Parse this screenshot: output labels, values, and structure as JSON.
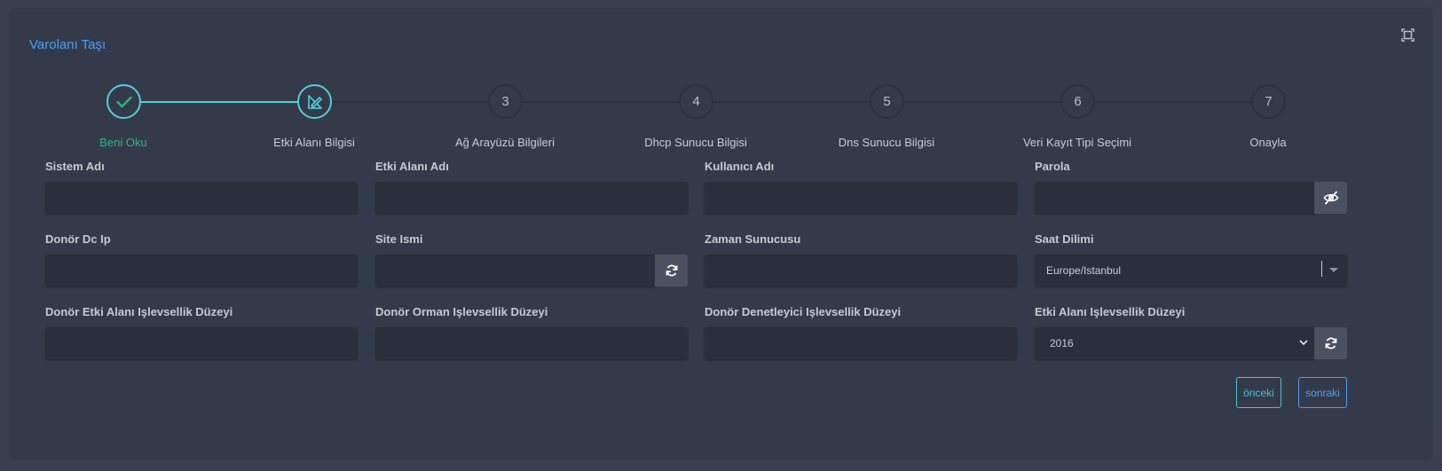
{
  "title": "Varolanı Taşı",
  "steps": [
    {
      "num": "1",
      "label": "Beni Oku",
      "state": "done"
    },
    {
      "num": "2",
      "label": "Etki Alanı Bilgisi",
      "state": "active"
    },
    {
      "num": "3",
      "label": "Ağ Arayüzü Bilgileri",
      "state": "pending"
    },
    {
      "num": "4",
      "label": "Dhcp Sunucu Bilgisi",
      "state": "pending"
    },
    {
      "num": "5",
      "label": "Dns Sunucu Bilgisi",
      "state": "pending"
    },
    {
      "num": "6",
      "label": "Veri Kayıt Tipi Seçimi",
      "state": "pending"
    },
    {
      "num": "7",
      "label": "Onayla",
      "state": "pending"
    }
  ],
  "form": {
    "system_name": {
      "label": "Sistem Adı",
      "value": ""
    },
    "domain_name": {
      "label": "Etki Alanı Adı",
      "value": ""
    },
    "username": {
      "label": "Kullanıcı Adı",
      "value": ""
    },
    "password": {
      "label": "Parola",
      "value": ""
    },
    "donor_dc_ip": {
      "label": "Donör Dc Ip",
      "value": ""
    },
    "site_name": {
      "label": "Site Ismi",
      "value": ""
    },
    "time_server": {
      "label": "Zaman Sunucusu",
      "value": ""
    },
    "timezone": {
      "label": "Saat Dilimi",
      "value": "Europe/Istanbul"
    },
    "donor_domain_level": {
      "label": "Donör Etki Alanı Işlevsellik Düzeyi",
      "value": ""
    },
    "donor_forest_level": {
      "label": "Donör Orman Işlevsellik Düzeyi",
      "value": ""
    },
    "donor_dc_level": {
      "label": "Donör Denetleyici Işlevsellik Düzeyi",
      "value": ""
    },
    "domain_level": {
      "label": "Etki Alanı Işlevsellik Düzeyi",
      "value": "2016"
    }
  },
  "buttons": {
    "prev": "önceki",
    "next": "sonraki"
  },
  "icons": {
    "expand": "expand-icon",
    "step_done": "check-icon",
    "step_active": "pencil-ruler-icon",
    "password_toggle": "eye-slash-icon",
    "refresh": "refresh-icon"
  },
  "colors": {
    "accent_blue": "#4a9ff5",
    "accent_cyan": "#4fd1d9",
    "success_green": "#29b87b",
    "panel_bg": "#353a4a",
    "input_bg": "#2b2f3c"
  }
}
